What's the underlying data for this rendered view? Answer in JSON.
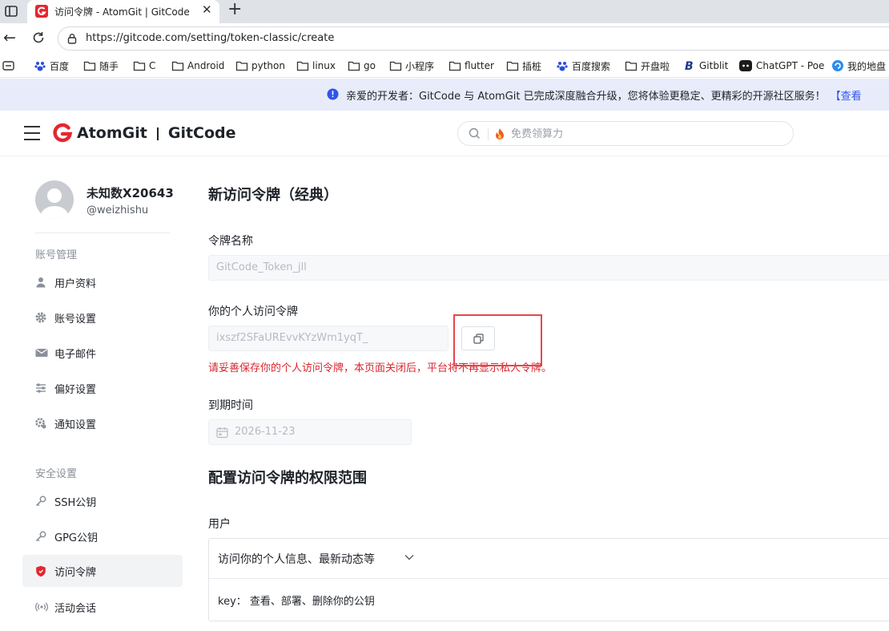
{
  "browser": {
    "tab_title": "访问令牌 - AtomGit | GitCode",
    "tab_close": "✕",
    "new_tab": "+",
    "url": "https://gitcode.com/setting/token-classic/create",
    "bookmarks": [
      {
        "label": "百度",
        "icon": "baidu-icon"
      },
      {
        "label": "随手",
        "icon": "folder-icon"
      },
      {
        "label": "C",
        "icon": "folder-icon"
      },
      {
        "label": "Android",
        "icon": "folder-icon"
      },
      {
        "label": "python",
        "icon": "folder-icon"
      },
      {
        "label": "linux",
        "icon": "folder-icon"
      },
      {
        "label": "go",
        "icon": "folder-icon"
      },
      {
        "label": "小程序",
        "icon": "folder-icon"
      },
      {
        "label": "flutter",
        "icon": "folder-icon"
      },
      {
        "label": "插桩",
        "icon": "folder-icon"
      },
      {
        "label": "百度搜索",
        "icon": "baidu-icon"
      },
      {
        "label": "开盘啦",
        "icon": "folder-icon"
      },
      {
        "label": "Gitblit",
        "icon": "gitblit-icon"
      },
      {
        "label": "ChatGPT - Poe",
        "icon": "poe-icon"
      },
      {
        "label": "我的地盘",
        "icon": "chandao-icon"
      }
    ]
  },
  "notice": {
    "text": "亲爱的开发者：GitCode 与 AtomGit 已完成深度融合升级，您将体验更稳定、更精彩的开源社区服务！",
    "link": "【查看"
  },
  "header": {
    "brand_left": "AtomGit",
    "brand_right": "GitCode",
    "search_placeholder": "免费领算力"
  },
  "sidebar": {
    "user_name": "未知数X20643",
    "user_handle": "@weizhishu",
    "section_account": "账号管理",
    "section_security": "安全设置",
    "items": [
      {
        "label": "用户资料",
        "icon": "user-icon"
      },
      {
        "label": "账号设置",
        "icon": "gear-icon"
      },
      {
        "label": "电子邮件",
        "icon": "mail-icon"
      },
      {
        "label": "偏好设置",
        "icon": "sliders-icon"
      },
      {
        "label": "通知设置",
        "icon": "notification-gear-icon"
      },
      {
        "label": "SSH公钥",
        "icon": "key-icon"
      },
      {
        "label": "GPG公钥",
        "icon": "key-icon"
      },
      {
        "label": "访问令牌",
        "icon": "shield-icon"
      },
      {
        "label": "活动会话",
        "icon": "broadcast-icon"
      }
    ],
    "active_item": "访问令牌"
  },
  "main": {
    "title": "新访问令牌（经典）",
    "token_name_label": "令牌名称",
    "token_name_value": "GitCode_Token_jll",
    "token_label": "你的个人访问令牌",
    "token_value": "ixszf2SFaUREvvKYzWm1yqT_",
    "warning": "请妥善保存你的个人访问令牌，本页面关闭后，平台将不再显示私人令牌。",
    "expiry_label": "到期时间",
    "expiry_value": "2026-11-23",
    "scope_title": "配置访问令牌的权限范围",
    "scope_group_label": "用户",
    "scope_head": "访问你的个人信息、最新动态等",
    "scope_row": "key：  查看、部署、删除你的公钥"
  },
  "colors": {
    "accent": "#2f54eb",
    "brand_red": "#e5262f",
    "warning": "#d9262f",
    "highlight": "#e5474b"
  }
}
